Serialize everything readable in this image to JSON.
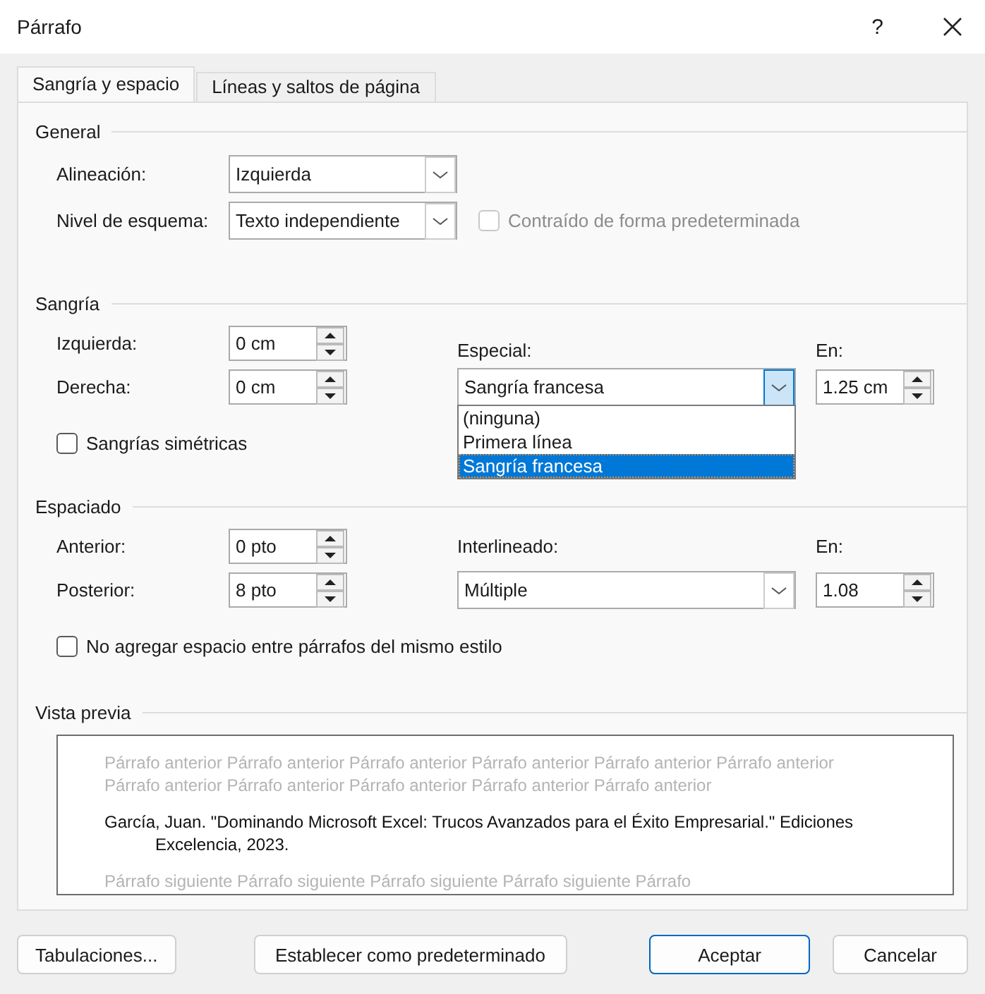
{
  "window": {
    "title": "Párrafo",
    "help": "?"
  },
  "tabs": [
    {
      "label": "Sangría y espacio",
      "selected": true
    },
    {
      "label": "Líneas y saltos de página",
      "selected": false
    }
  ],
  "general": {
    "title": "General",
    "alignment": {
      "label": "Alineación:",
      "value": "Izquierda"
    },
    "outline_level": {
      "label": "Nivel de esquema:",
      "value": "Texto independiente"
    },
    "collapsed_by_default": {
      "label": "Contraído de forma predeterminada",
      "checked": false,
      "disabled": true
    }
  },
  "indentation": {
    "title": "Sangría",
    "left": {
      "label": "Izquierda:",
      "value": "0 cm"
    },
    "right": {
      "label": "Derecha:",
      "value": "0 cm"
    },
    "special": {
      "label": "Especial:",
      "value": "Sangría francesa",
      "expanded": true,
      "options": [
        {
          "label": "(ninguna)",
          "selected": false
        },
        {
          "label": "Primera línea",
          "selected": false
        },
        {
          "label": "Sangría francesa",
          "selected": true
        }
      ]
    },
    "by": {
      "label": "En:",
      "value": "1.25 cm"
    },
    "mirror_indents": {
      "label": "Sangrías simétricas",
      "checked": false,
      "disabled": false
    }
  },
  "spacing": {
    "title": "Espaciado",
    "before": {
      "label": "Anterior:",
      "value": "0 pto"
    },
    "after": {
      "label": "Posterior:",
      "value": "8 pto"
    },
    "line_spacing": {
      "label": "Interlineado:",
      "value": "Múltiple",
      "expanded": false
    },
    "at": {
      "label": "En:",
      "value": "1.08"
    },
    "dont_add_space": {
      "label": "No agregar espacio entre párrafos del mismo estilo",
      "checked": false,
      "disabled": false
    }
  },
  "preview": {
    "title": "Vista previa",
    "previous_lines": [
      "Párrafo anterior Párrafo anterior Párrafo anterior Párrafo anterior Párrafo anterior Párrafo anterior",
      "Párrafo anterior Párrafo anterior Párrafo anterior Párrafo anterior Párrafo anterior"
    ],
    "current_lines": [
      "García, Juan. \"Dominando Microsoft Excel: Trucos Avanzados para el Éxito Empresarial.\" Ediciones",
      "Excelencia, 2023."
    ],
    "next_lines": [
      "Párrafo siguiente Párrafo siguiente Párrafo siguiente Párrafo siguiente Párrafo"
    ]
  },
  "buttons": [
    {
      "label": "Tabulaciones...",
      "default": false
    },
    {
      "label": "Establecer como predeterminado",
      "default": false
    },
    {
      "label": "Aceptar",
      "default": true
    },
    {
      "label": "Cancelar",
      "default": false
    }
  ]
}
